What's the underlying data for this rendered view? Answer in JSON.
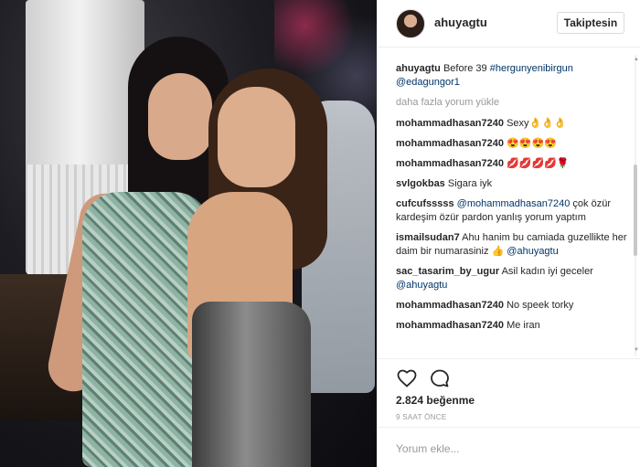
{
  "post": {
    "username": "ahuyagtu",
    "follow_label": "Takiptesin",
    "caption": {
      "user": "ahuyagtu",
      "text": "Before 39",
      "hashtag": "#hergunyenibirgun",
      "mention": "@edagungor1"
    },
    "load_more": "daha fazla yorum yükle",
    "comments": [
      {
        "user": "mohammadhasan7240",
        "text": "Sexy👌👌👌"
      },
      {
        "user": "mohammadhasan7240",
        "text": "😍😍😍😍"
      },
      {
        "user": "mohammadhasan7240",
        "text": "💋💋💋💋🌹"
      },
      {
        "user": "svlgokbas",
        "text": "Sigara iyk"
      },
      {
        "user": "cufcufsssss",
        "mention": "@mohammadhasan7240",
        "text": "çok özür kardeşim özür pardon yanlış yorum yaptım"
      },
      {
        "user": "ismailsudan7",
        "text": "Ahu hanim bu camiada guzellikte her daim bir numarasiniz 👍",
        "mention_after": "@ahuyagtu"
      },
      {
        "user": "sac_tasarim_by_ugur",
        "text": "Asil kadın iyi geceler",
        "mention_after": "@ahuyagtu"
      },
      {
        "user": "mohammadhasan7240",
        "text": "No speek torky"
      },
      {
        "user": "mohammadhasan7240",
        "text": "Me iran"
      }
    ],
    "likes": "2.824 beğenme",
    "time": "9 SAAT ÖNCE",
    "comment_placeholder": "Yorum ekle..."
  },
  "icons": {
    "heart": "heart-icon",
    "comment": "comment-icon"
  },
  "colors": {
    "link": "#003569",
    "muted": "#999999",
    "text": "#262626"
  }
}
